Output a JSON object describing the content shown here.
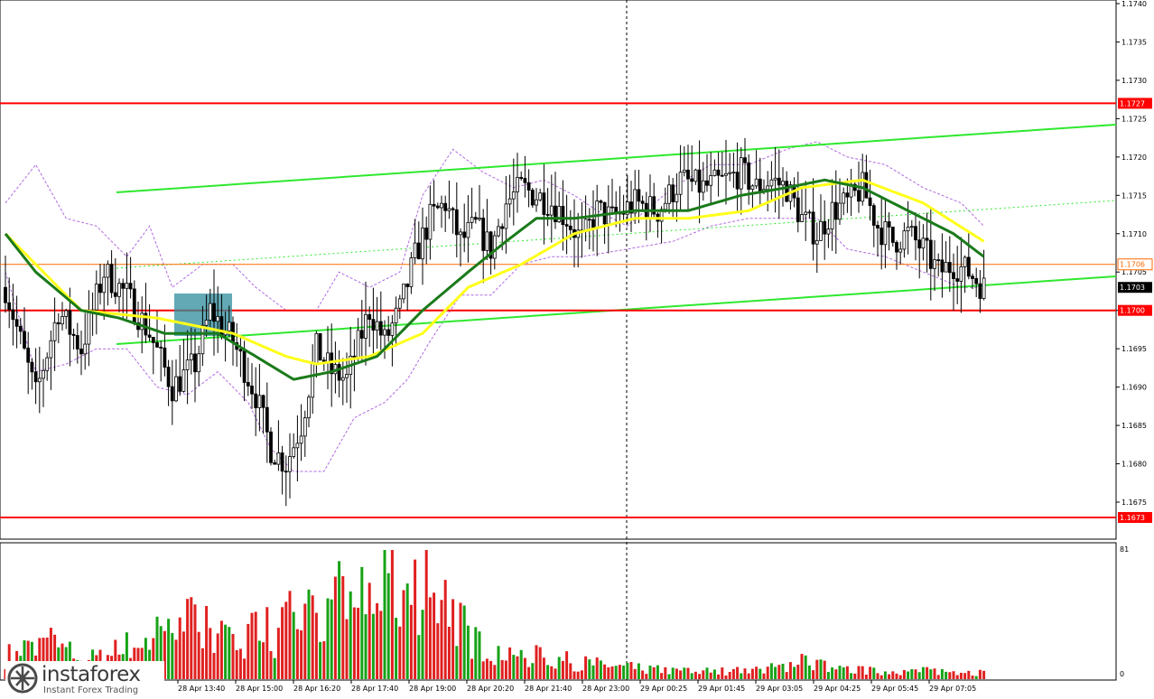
{
  "chart_data": {
    "type": "candlestick",
    "title": "",
    "y_ticks": [
      "1.1740",
      "1.1735",
      "1.1730",
      "1.1725",
      "1.1720",
      "1.1715",
      "1.1710",
      "1.1705",
      "1.1700",
      "1.1695",
      "1.1690",
      "1.1685",
      "1.1680",
      "1.1675"
    ],
    "ylim": [
      1.1671,
      1.1741
    ],
    "x_ticks": [
      "28 Apr 13:40",
      "28 Apr 15:00",
      "28 Apr 16:20",
      "28 Apr 17:40",
      "28 Apr 19:00",
      "28 Apr 20:20",
      "28 Apr 21:40",
      "28 Apr 23:00",
      "29 Apr 00:25",
      "29 Apr 01:45",
      "29 Apr 03:05",
      "29 Apr 04:25",
      "29 Apr 05:45",
      "29 Apr 07:05"
    ],
    "x_tick_partial": "0",
    "horizontal_levels": [
      {
        "label": "1.1727",
        "value": 1.1727,
        "color": "#ff0000"
      },
      {
        "label": "1.1700",
        "value": 1.17,
        "color": "#ff0000"
      },
      {
        "label": "1.1673",
        "value": 1.1673,
        "color": "#ff0000"
      }
    ],
    "price_markers": [
      {
        "label": "1.1706",
        "value": 1.1706,
        "color": "#ff6a00"
      },
      {
        "label": "1.1703",
        "value": 1.1703,
        "color": "#000000"
      }
    ],
    "price_anchors": [
      [
        0,
        1.1703
      ],
      [
        8,
        1.1689
      ],
      [
        14,
        1.17
      ],
      [
        20,
        1.1695
      ],
      [
        26,
        1.1705
      ],
      [
        32,
        1.1702
      ],
      [
        38,
        1.1697
      ],
      [
        44,
        1.169
      ],
      [
        50,
        1.1693
      ],
      [
        54,
        1.17
      ],
      [
        60,
        1.1696
      ],
      [
        66,
        1.1689
      ],
      [
        70,
        1.1682
      ],
      [
        74,
        1.168
      ],
      [
        78,
        1.1685
      ],
      [
        82,
        1.1695
      ],
      [
        86,
        1.1692
      ],
      [
        90,
        1.1691
      ],
      [
        96,
        1.17
      ],
      [
        100,
        1.1696
      ],
      [
        104,
        1.17
      ],
      [
        108,
        1.1707
      ],
      [
        112,
        1.1712
      ],
      [
        116,
        1.1714
      ],
      [
        120,
        1.1709
      ],
      [
        124,
        1.1711
      ],
      [
        128,
        1.1708
      ],
      [
        132,
        1.1714
      ],
      [
        136,
        1.1716
      ],
      [
        140,
        1.1715
      ],
      [
        144,
        1.1714
      ],
      [
        148,
        1.1712
      ],
      [
        152,
        1.1709
      ],
      [
        156,
        1.1713
      ],
      [
        160,
        1.1712
      ],
      [
        166,
        1.1714
      ],
      [
        172,
        1.1713
      ],
      [
        178,
        1.1717
      ],
      [
        184,
        1.1716
      ],
      [
        190,
        1.1717
      ],
      [
        194,
        1.1718
      ],
      [
        198,
        1.1716
      ],
      [
        202,
        1.1717
      ],
      [
        206,
        1.1716
      ],
      [
        210,
        1.1712
      ],
      [
        214,
        1.171
      ],
      [
        218,
        1.1713
      ],
      [
        222,
        1.1714
      ],
      [
        226,
        1.1716
      ],
      [
        230,
        1.1711
      ],
      [
        234,
        1.1709
      ],
      [
        238,
        1.171
      ],
      [
        242,
        1.1708
      ],
      [
        246,
        1.1705
      ],
      [
        250,
        1.1706
      ],
      [
        254,
        1.1705
      ],
      [
        258,
        1.1703
      ]
    ],
    "volume": {
      "ymax_label": "81",
      "ymin_label": "0",
      "ylim": [
        0,
        81
      ],
      "anchors": [
        [
          0,
          14
        ],
        [
          6,
          20
        ],
        [
          12,
          22
        ],
        [
          18,
          15
        ],
        [
          24,
          12
        ],
        [
          30,
          18
        ],
        [
          36,
          24
        ],
        [
          42,
          30
        ],
        [
          48,
          38
        ],
        [
          54,
          28
        ],
        [
          60,
          22
        ],
        [
          66,
          35
        ],
        [
          72,
          28
        ],
        [
          78,
          45
        ],
        [
          84,
          40
        ],
        [
          90,
          52
        ],
        [
          96,
          48
        ],
        [
          102,
          60
        ],
        [
          108,
          45
        ],
        [
          112,
          40
        ],
        [
          116,
          50
        ],
        [
          122,
          28
        ],
        [
          128,
          20
        ],
        [
          134,
          16
        ],
        [
          140,
          14
        ],
        [
          146,
          12
        ],
        [
          152,
          10
        ],
        [
          160,
          8
        ],
        [
          170,
          6
        ],
        [
          180,
          5
        ],
        [
          190,
          5
        ],
        [
          200,
          6
        ],
        [
          206,
          8
        ],
        [
          210,
          14
        ],
        [
          214,
          10
        ],
        [
          220,
          6
        ],
        [
          230,
          5
        ],
        [
          240,
          5
        ],
        [
          250,
          5
        ],
        [
          258,
          4
        ]
      ],
      "peaks": [
        [
          108,
          75
        ],
        [
          111,
          81
        ],
        [
          91,
          55
        ],
        [
          106,
          60
        ],
        [
          86,
          50
        ]
      ]
    },
    "moving_averages": [
      {
        "name": "",
        "color": "#ffff1a",
        "anchors": [
          [
            0,
            1.171
          ],
          [
            20,
            1.17
          ],
          [
            40,
            1.1699
          ],
          [
            60,
            1.1697
          ],
          [
            74,
            1.1694
          ],
          [
            82,
            1.1693
          ],
          [
            96,
            1.1694
          ],
          [
            110,
            1.1697
          ],
          [
            122,
            1.1703
          ],
          [
            136,
            1.1706
          ],
          [
            150,
            1.171
          ],
          [
            166,
            1.1712
          ],
          [
            180,
            1.1712
          ],
          [
            196,
            1.1713
          ],
          [
            210,
            1.1716
          ],
          [
            226,
            1.1717
          ],
          [
            242,
            1.1714
          ],
          [
            258,
            1.1709
          ]
        ]
      },
      {
        "name": "",
        "color": "#1a7a1a",
        "anchors": [
          [
            0,
            1.171
          ],
          [
            8,
            1.1705
          ],
          [
            20,
            1.17
          ],
          [
            30,
            1.1699
          ],
          [
            42,
            1.1697
          ],
          [
            56,
            1.1697
          ],
          [
            66,
            1.1694
          ],
          [
            76,
            1.1691
          ],
          [
            86,
            1.1692
          ],
          [
            98,
            1.1694
          ],
          [
            110,
            1.17
          ],
          [
            122,
            1.1705
          ],
          [
            132,
            1.1709
          ],
          [
            140,
            1.1712
          ],
          [
            150,
            1.1712
          ],
          [
            166,
            1.1713
          ],
          [
            180,
            1.1713
          ],
          [
            194,
            1.1715
          ],
          [
            206,
            1.1716
          ],
          [
            216,
            1.1717
          ],
          [
            226,
            1.1716
          ],
          [
            238,
            1.1713
          ],
          [
            250,
            1.171
          ],
          [
            258,
            1.1707
          ]
        ]
      }
    ],
    "envelope": {
      "color": "#b06ae0",
      "upper_anchors": [
        [
          0,
          1.1714
        ],
        [
          8,
          1.1719
        ],
        [
          16,
          1.1712
        ],
        [
          24,
          1.1711
        ],
        [
          32,
          1.1707
        ],
        [
          38,
          1.1711
        ],
        [
          44,
          1.1703
        ],
        [
          52,
          1.1706
        ],
        [
          60,
          1.1706
        ],
        [
          66,
          1.1703
        ],
        [
          74,
          1.17
        ],
        [
          82,
          1.17
        ],
        [
          88,
          1.1705
        ],
        [
          96,
          1.1703
        ],
        [
          104,
          1.1705
        ],
        [
          110,
          1.1715
        ],
        [
          118,
          1.1721
        ],
        [
          126,
          1.1718
        ],
        [
          134,
          1.1716
        ],
        [
          142,
          1.1717
        ],
        [
          150,
          1.1715
        ],
        [
          156,
          1.1713
        ],
        [
          164,
          1.1711
        ],
        [
          176,
          1.1716
        ],
        [
          186,
          1.1719
        ],
        [
          196,
          1.1719
        ],
        [
          206,
          1.1721
        ],
        [
          214,
          1.1722
        ],
        [
          222,
          1.172
        ],
        [
          232,
          1.1719
        ],
        [
          242,
          1.1716
        ],
        [
          252,
          1.1714
        ],
        [
          258,
          1.1711
        ]
      ],
      "lower_anchors": [
        [
          0,
          1.1705
        ],
        [
          8,
          1.1692
        ],
        [
          16,
          1.1693
        ],
        [
          24,
          1.1695
        ],
        [
          32,
          1.1695
        ],
        [
          40,
          1.169
        ],
        [
          48,
          1.1689
        ],
        [
          56,
          1.1692
        ],
        [
          64,
          1.1688
        ],
        [
          70,
          1.1682
        ],
        [
          76,
          1.1679
        ],
        [
          84,
          1.1679
        ],
        [
          92,
          1.1686
        ],
        [
          100,
          1.1688
        ],
        [
          106,
          1.1691
        ],
        [
          112,
          1.1696
        ],
        [
          120,
          1.1702
        ],
        [
          128,
          1.1702
        ],
        [
          136,
          1.1706
        ],
        [
          144,
          1.1707
        ],
        [
          152,
          1.1707
        ],
        [
          164,
          1.1708
        ],
        [
          176,
          1.1709
        ],
        [
          186,
          1.1711
        ],
        [
          196,
          1.1712
        ],
        [
          206,
          1.1712
        ],
        [
          214,
          1.1712
        ],
        [
          222,
          1.1708
        ],
        [
          232,
          1.1707
        ],
        [
          242,
          1.1705
        ],
        [
          252,
          1.1703
        ],
        [
          258,
          1.1703
        ]
      ]
    }
  },
  "branding": {
    "logo_text": "instaforex",
    "logo_tagline": "Instant Forex Trading"
  }
}
